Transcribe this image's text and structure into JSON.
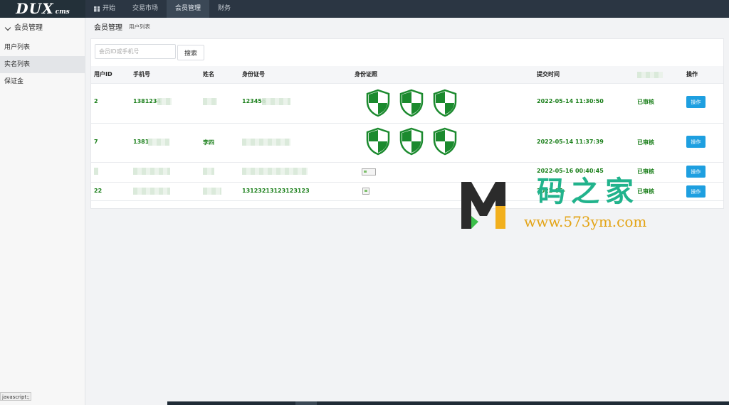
{
  "app": {
    "logo_main": "DUX",
    "logo_sub": "cms"
  },
  "nav": [
    {
      "label": "开始",
      "icon": "windows-icon"
    },
    {
      "label": "交易市场"
    },
    {
      "label": "会员管理",
      "active": true
    },
    {
      "label": "财务"
    }
  ],
  "sidebar": {
    "header": "会员管理",
    "items": [
      {
        "label": "用户列表"
      },
      {
        "label": "实名列表",
        "active": true
      },
      {
        "label": "保证金"
      }
    ]
  },
  "breadcrumb": {
    "title": "会员管理",
    "sub": "用户列表"
  },
  "search": {
    "placeholder": "会员ID或手机号",
    "button": "搜索"
  },
  "table": {
    "headers": [
      "用户ID",
      "手机号",
      "姓名",
      "身份证号",
      "身份证照",
      "提交时间",
      "",
      "操作"
    ],
    "rows": [
      {
        "id": "2",
        "phone": "1381234",
        "name": "",
        "idcard": "123456",
        "time": "2022-05-14 11:30:50",
        "status": "已审核",
        "action": "操作"
      },
      {
        "id": "7",
        "phone": "1381",
        "name": "李四",
        "idcard": "",
        "time": "2022-05-14 11:37:39",
        "status": "已审核",
        "action": "操作"
      },
      {
        "id": "",
        "phone": "",
        "name": "",
        "idcard": "",
        "time": "2022-05-16 00:40:45",
        "status": "已审核",
        "action": "操作"
      },
      {
        "id": "22",
        "phone": "",
        "name": "",
        "idcard": "13123213123123123",
        "time": "2022-05-",
        "status": "已审核",
        "action": "操作"
      }
    ]
  },
  "statusbar": "javascript:;",
  "watermark": {
    "cn": "码之家",
    "url": "www.573ym.com"
  },
  "colors": {
    "topbar": "#2b3643",
    "accent_green": "#1a7f1a",
    "button_blue": "#1e9fe0"
  }
}
